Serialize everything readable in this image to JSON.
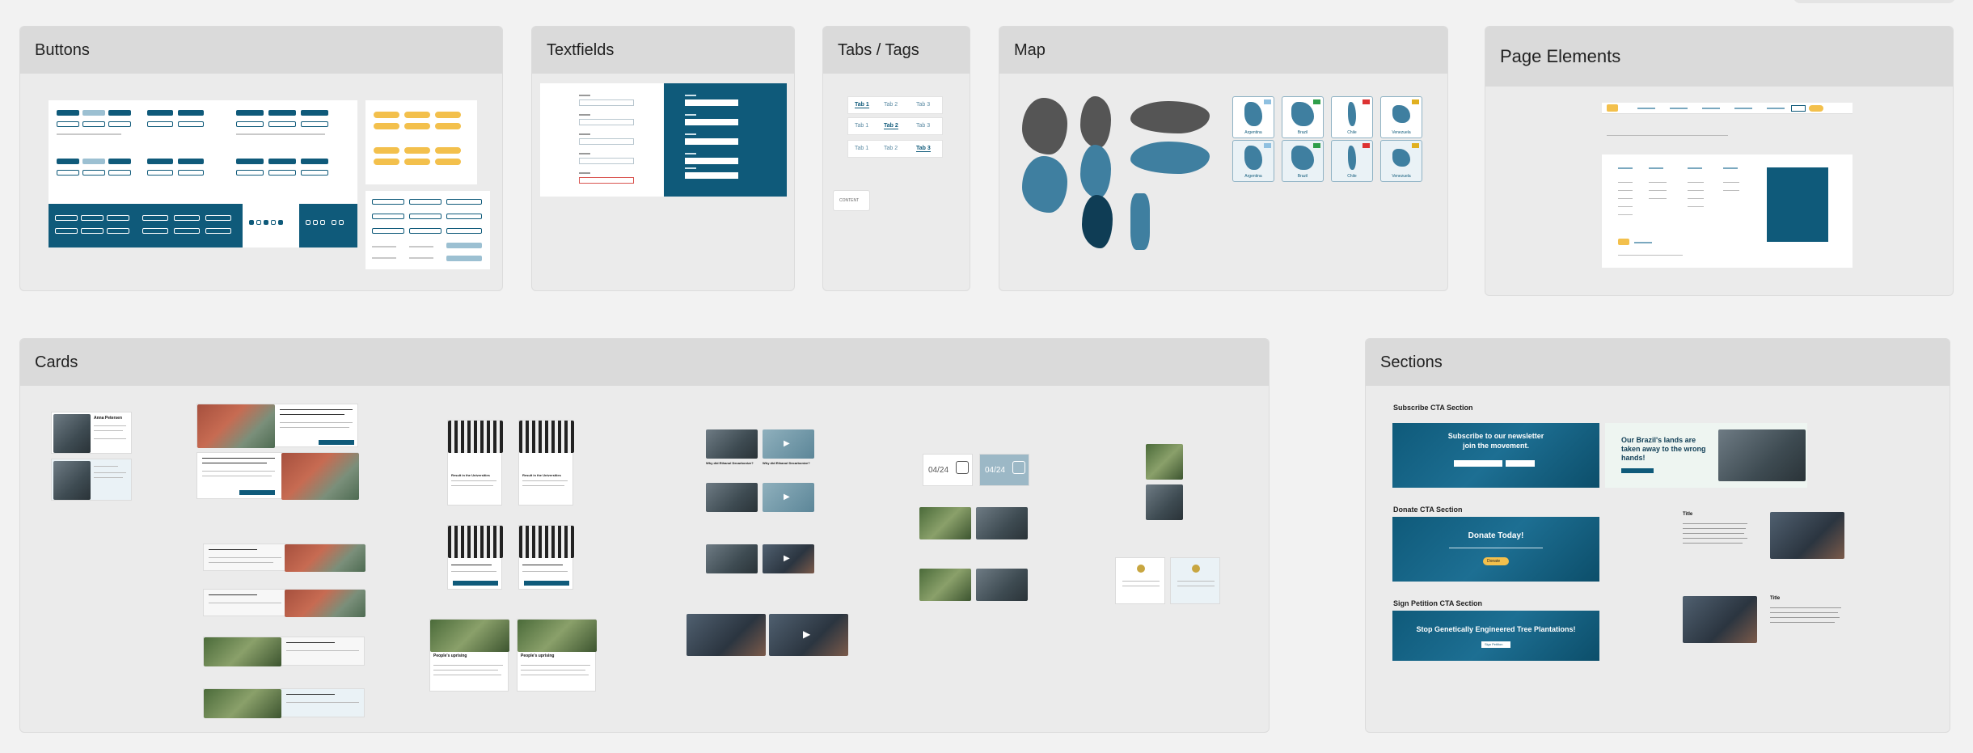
{
  "panels": {
    "buttons": {
      "title": "Buttons"
    },
    "textfields": {
      "title": "Textfields"
    },
    "tabs": {
      "title": "Tabs / Tags"
    },
    "map": {
      "title": "Map"
    },
    "page_elements": {
      "title": "Page Elements"
    },
    "cards": {
      "title": "Cards"
    },
    "sections": {
      "title": "Sections"
    }
  },
  "tabs_panel": {
    "row1": [
      "Tab 1",
      "Tab 2",
      "Tab 3"
    ],
    "row2": [
      "Tab 1",
      "Tab 2",
      "Tab 3"
    ],
    "row3": [
      "Tab 1",
      "Tab 2",
      "Tab 3"
    ],
    "tag": "CONTENT"
  },
  "map_panel": {
    "countries": [
      "Argentina",
      "Brazil",
      "Chile",
      "Venezuela",
      "Argentina",
      "Brazil",
      "Chile",
      "Venezuela"
    ]
  },
  "cards_panel": {
    "counter_a": "04/24",
    "counter_b": "04/24",
    "bw_title_a": "Result in the Universities",
    "bw_title_b": "Result in the Universities",
    "people_a": "People's uprising",
    "people_b": "People's uprising",
    "video_a": "Why did Ethanol Decarbonize?",
    "video_b": "Why did Ethanol Decarbonize?",
    "person_name": "Anna Petersen"
  },
  "sections_panel": {
    "subscribe_label": "Subscribe CTA Section",
    "subscribe_heading": "Subscribe to our newsletter\njoin the movement.",
    "brazil_heading": "Our Brazil's lands are taken away to the wrong hands!",
    "donate_label": "Donate CTA Section",
    "donate_heading": "Donate Today!",
    "donate_button": "Donate",
    "petition_label": "Sign Petition CTA Section",
    "petition_heading": "Stop Genetically Engineered Tree Plantations!",
    "petition_button": "Sign Petition",
    "title_a": "Title",
    "title_b": "Title"
  },
  "colors": {
    "primary": "#0f5a7a",
    "accent": "#f3c04c",
    "panel_bg": "#ebebeb",
    "header_bg": "#dadada"
  }
}
